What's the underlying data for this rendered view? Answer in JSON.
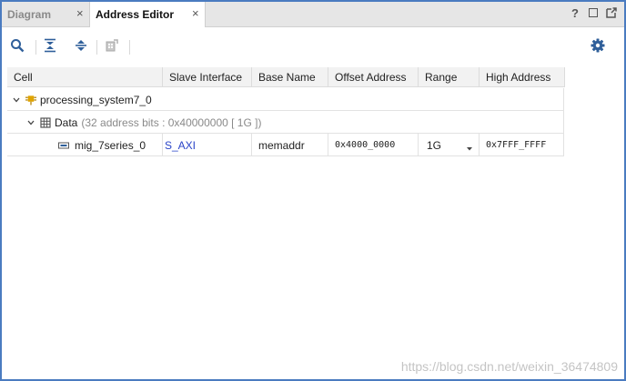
{
  "tabs": [
    {
      "label": "Diagram",
      "close": "×"
    },
    {
      "label": "Address Editor",
      "close": "×"
    }
  ],
  "window_controls": {
    "help": "?"
  },
  "toolbar": {
    "icons": [
      "search-icon",
      "collapse-all-icon",
      "expand-all-icon",
      "auto-assign-icon"
    ],
    "settings_icon": "gear-icon"
  },
  "table": {
    "columns": [
      "Cell",
      "Slave Interface",
      "Base Name",
      "Offset Address",
      "Range",
      "High Address"
    ],
    "rows": [
      {
        "cell": "processing_system7_0"
      },
      {
        "cell": "Data",
        "note": "(32 address bits : 0x40000000 [ 1G ])"
      },
      {
        "cell": "mig_7series_0",
        "slave_interface": "S_AXI",
        "base_name": "memaddr",
        "offset_address": "0x4000_0000",
        "range": "1G",
        "high_address": "0x7FFF_FFFF"
      }
    ]
  },
  "watermark": "https://blog.csdn.net/weixin_36474809",
  "colors": {
    "frame": "#4a7bc0",
    "link": "#2a44c8",
    "accent": "#2f5f9a",
    "ip_icon": "#e0a400"
  }
}
